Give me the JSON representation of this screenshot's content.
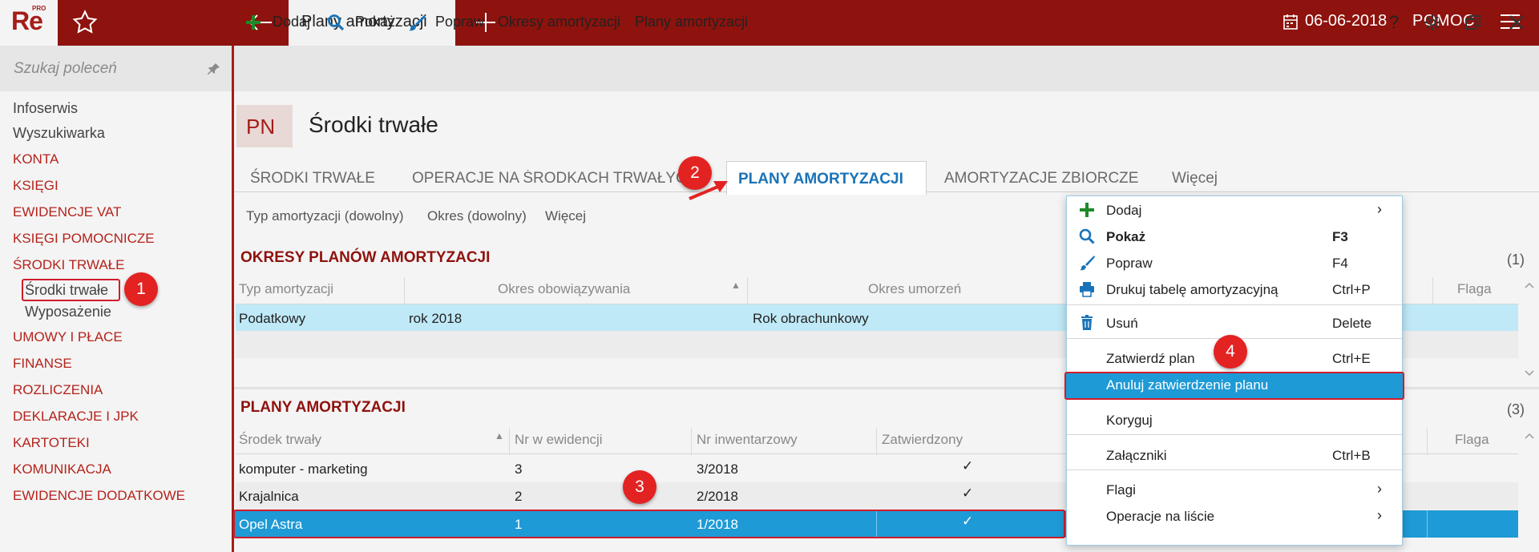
{
  "app": {
    "logo": "Re",
    "logo_sup": "PRO",
    "tab_title": "Plany amortyzacji",
    "date": "06-06-2018",
    "help": "POMOC"
  },
  "sidebar": {
    "search_placeholder": "Szukaj poleceń",
    "items": [
      {
        "label": "Infoserwis",
        "kind": "plain"
      },
      {
        "label": "Wyszukiwarka",
        "kind": "plain"
      },
      {
        "label": "KONTA",
        "kind": "section"
      },
      {
        "label": "KSIĘGI",
        "kind": "section"
      },
      {
        "label": "EWIDENCJE VAT",
        "kind": "section"
      },
      {
        "label": "KSIĘGI POMOCNICZE",
        "kind": "section"
      },
      {
        "label": "ŚRODKI TRWAŁE",
        "kind": "section"
      },
      {
        "label": "Środki trwałe",
        "kind": "sub"
      },
      {
        "label": "Wyposażenie",
        "kind": "sub"
      },
      {
        "label": "UMOWY I PŁACE",
        "kind": "section"
      },
      {
        "label": "FINANSE",
        "kind": "section"
      },
      {
        "label": "ROZLICZENIA",
        "kind": "section"
      },
      {
        "label": "DEKLARACJE I JPK",
        "kind": "section"
      },
      {
        "label": "KARTOTEKI",
        "kind": "section"
      },
      {
        "label": "KOMUNIKACJA",
        "kind": "section"
      },
      {
        "label": "EWIDENCJE DODATKOWE",
        "kind": "section"
      }
    ]
  },
  "toolbar": {
    "add": "Dodaj",
    "show": "Pokaż",
    "edit": "Popraw",
    "periods": "Okresy amortyzacji",
    "plans": "Plany amortyzacji",
    "help_q": "?"
  },
  "page": {
    "badge": "PN",
    "title": "Środki trwałe"
  },
  "tabs": [
    "ŚRODKI TRWAŁE",
    "OPERACJE NA ŚRODKACH TRWAŁYCH",
    "PLANY AMORTYZACJI",
    "AMORTYZACJE ZBIORCZE",
    "Więcej"
  ],
  "filters": [
    "Typ amortyzacji (dowolny)",
    "Okres (dowolny)",
    "Więcej"
  ],
  "periods_table": {
    "title": "OKRESY PLANÓW AMORTYZACJI",
    "count": "(1)",
    "headers": [
      "Typ amortyzacji",
      "Okres obowiązywania",
      "Okres umorzeń",
      "Flaga"
    ],
    "rows": [
      [
        "Podatkowy",
        "rok 2018",
        "Rok obrachunkowy"
      ]
    ]
  },
  "plans_table": {
    "title": "PLANY AMORTYZACJI",
    "count": "(3)",
    "headers": [
      "Środek trwały",
      "Nr w ewidencji",
      "Nr inwentarzowy",
      "Zatwierdzony",
      "Flaga"
    ],
    "rows": [
      [
        "komputer - marketing",
        "3",
        "3/2018",
        "✓"
      ],
      [
        "Krajalnica",
        "2",
        "2/2018",
        "✓"
      ],
      [
        "Opel Astra",
        "1",
        "1/2018",
        "✓"
      ]
    ]
  },
  "context_menu": {
    "items": [
      {
        "label": "Dodaj",
        "shortcut": "",
        "submenu": "›"
      },
      {
        "label": "Pokaż",
        "shortcut": "F3"
      },
      {
        "label": "Popraw",
        "shortcut": "F4"
      },
      {
        "label": "Drukuj tabelę amortyzacyjną",
        "shortcut": "Ctrl+P"
      },
      {
        "label": "Usuń",
        "shortcut": "Delete"
      },
      {
        "label": "Zatwierdź plan",
        "shortcut": "Ctrl+E"
      },
      {
        "label": "Anuluj zatwierdzenie planu",
        "shortcut": ""
      },
      {
        "label": "Koryguj",
        "shortcut": ""
      },
      {
        "label": "Załączniki",
        "shortcut": "Ctrl+B"
      },
      {
        "label": "Flagi",
        "shortcut": "",
        "submenu": "›"
      },
      {
        "label": "Operacje na liście",
        "shortcut": "",
        "submenu": "›"
      }
    ]
  },
  "annotations": [
    "1",
    "2",
    "3",
    "4"
  ],
  "colors": {
    "brand": "#8e120d",
    "accent_blue": "#1e9ad6",
    "light_blue": "#bfe9f7",
    "callout_red": "#e32222"
  }
}
